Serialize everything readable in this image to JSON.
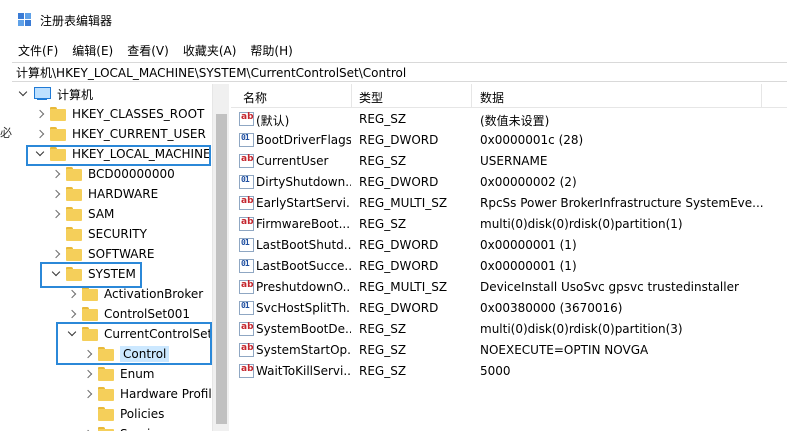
{
  "window": {
    "title": "注册表编辑器"
  },
  "menu": [
    "文件(F)",
    "编辑(E)",
    "查看(V)",
    "收藏夹(A)",
    "帮助(H)"
  ],
  "address": "计算机\\HKEY_LOCAL_MACHINE\\SYSTEM\\CurrentControlSet\\Control",
  "left_clip": "必",
  "tree": [
    {
      "label": "计算机",
      "expander": "down",
      "kind": "computer"
    },
    {
      "label": "HKEY_CLASSES_ROOT",
      "expander": "right",
      "kind": "folder"
    },
    {
      "label": "HKEY_CURRENT_USER",
      "expander": "right",
      "kind": "folder"
    },
    {
      "label": "HKEY_LOCAL_MACHINE",
      "expander": "down",
      "kind": "folder"
    },
    {
      "label": "BCD00000000",
      "expander": "right",
      "kind": "folder"
    },
    {
      "label": "HARDWARE",
      "expander": "right",
      "kind": "folder"
    },
    {
      "label": "SAM",
      "expander": "right",
      "kind": "folder"
    },
    {
      "label": "SECURITY",
      "expander": "none",
      "kind": "folder"
    },
    {
      "label": "SOFTWARE",
      "expander": "right",
      "kind": "folder"
    },
    {
      "label": "SYSTEM",
      "expander": "down",
      "kind": "folder"
    },
    {
      "label": "ActivationBroker",
      "expander": "right",
      "kind": "folder"
    },
    {
      "label": "ControlSet001",
      "expander": "right",
      "kind": "folder"
    },
    {
      "label": "CurrentControlSet",
      "expander": "down",
      "kind": "folder"
    },
    {
      "label": "Control",
      "expander": "right",
      "kind": "folder",
      "selected": true
    },
    {
      "label": "Enum",
      "expander": "right",
      "kind": "folder"
    },
    {
      "label": "Hardware Profil",
      "expander": "right",
      "kind": "folder"
    },
    {
      "label": "Policies",
      "expander": "none",
      "kind": "folder"
    },
    {
      "label": "Servi",
      "expander": "right",
      "kind": "folder"
    }
  ],
  "columns": {
    "name": "名称",
    "type": "类型",
    "data": "数据"
  },
  "values": [
    {
      "name": "(默认)",
      "type": "REG_SZ",
      "data": "(数值未设置)",
      "icon": "sz"
    },
    {
      "name": "BootDriverFlags",
      "type": "REG_DWORD",
      "data": "0x0000001c (28)",
      "icon": "dw"
    },
    {
      "name": "CurrentUser",
      "type": "REG_SZ",
      "data": "USERNAME",
      "icon": "sz"
    },
    {
      "name": "DirtyShutdown...",
      "type": "REG_DWORD",
      "data": "0x00000002 (2)",
      "icon": "dw"
    },
    {
      "name": "EarlyStartServi...",
      "type": "REG_MULTI_SZ",
      "data": "RpcSs Power BrokerInfrastructure SystemEve...",
      "icon": "sz"
    },
    {
      "name": "FirmwareBoot...",
      "type": "REG_SZ",
      "data": "multi(0)disk(0)rdisk(0)partition(1)",
      "icon": "sz"
    },
    {
      "name": "LastBootShutd...",
      "type": "REG_DWORD",
      "data": "0x00000001 (1)",
      "icon": "dw"
    },
    {
      "name": "LastBootSucce...",
      "type": "REG_DWORD",
      "data": "0x00000001 (1)",
      "icon": "dw"
    },
    {
      "name": "PreshutdownO...",
      "type": "REG_MULTI_SZ",
      "data": "DeviceInstall UsoSvc gpsvc trustedinstaller",
      "icon": "sz"
    },
    {
      "name": "SvcHostSplitTh...",
      "type": "REG_DWORD",
      "data": "0x00380000 (3670016)",
      "icon": "dw"
    },
    {
      "name": "SystemBootDe...",
      "type": "REG_SZ",
      "data": "multi(0)disk(0)rdisk(0)partition(3)",
      "icon": "sz"
    },
    {
      "name": "SystemStartOp...",
      "type": "REG_SZ",
      "data": " NOEXECUTE=OPTIN  NOVGA",
      "icon": "sz"
    },
    {
      "name": "WaitToKillServi...",
      "type": "REG_SZ",
      "data": "5000",
      "icon": "sz"
    }
  ],
  "colors": {
    "highlight": "#2b88d8",
    "selection": "#cce8ff",
    "folder": "#f5cf5a"
  }
}
